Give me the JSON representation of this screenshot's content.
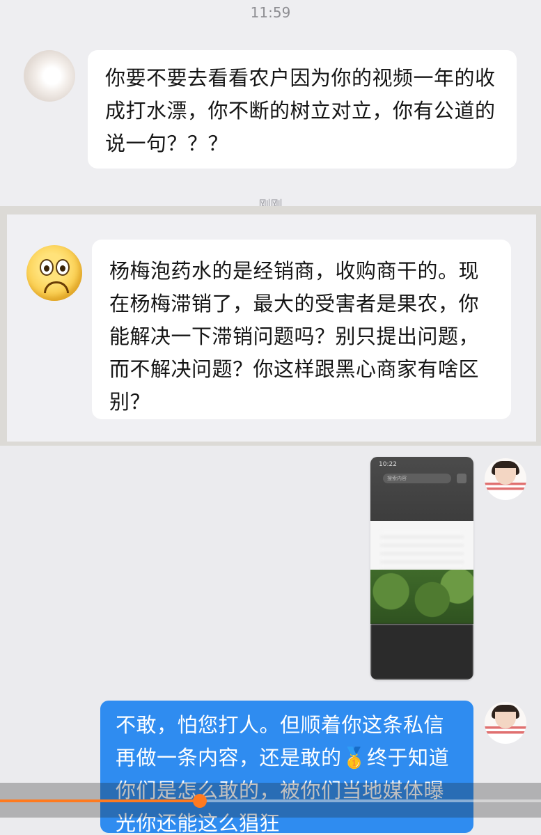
{
  "panel1": {
    "time": "11:59",
    "message": "你要不要去看看农户因为你的视频一年的收成打水漂，你不断的树立对立，你有公道的说一句？？？",
    "sub_time": "刚刚"
  },
  "panel2": {
    "message": "杨梅泡药水的是经销商，收购商干的。现在杨梅滞销了，最大的受害者是果农，你能解决一下滞销问题吗？别只提出问题，而不解决问题？你这样跟黑心商家有啥区别？"
  },
  "panel3": {
    "thumbnail": {
      "time": "10:22",
      "search_text": "搜索内容"
    },
    "reply": "不敢，怕您打人。但顺着你这条私信再做一条内容，还是敢的🥇终于知道你们是怎么敢的，被你们当地媒体曝光你还能这么猖狂"
  },
  "video": {
    "progress": 0.37,
    "accent_color": "#ff7a1f"
  },
  "colors": {
    "bubble_blue": "#2f8cf0",
    "bubble_white": "#ffffff"
  }
}
